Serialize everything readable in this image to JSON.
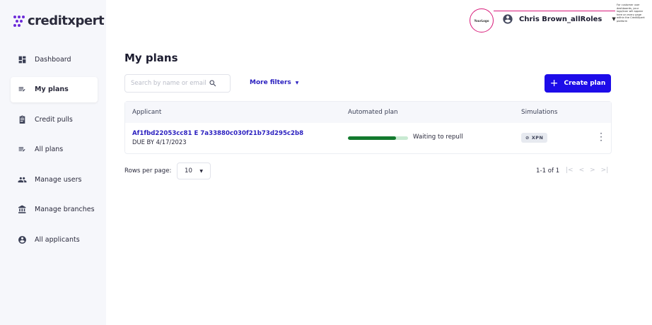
{
  "brand": {
    "name": "creditxpert",
    "color": "#6c2bd9"
  },
  "header": {
    "logo_placeholder": "YourLogo",
    "callout_note": "For customer user dashboards, your logo/icon will appear here on every page within the CreditXpert platform",
    "user_name": "Chris Brown_allRoles",
    "user_icon": "account-circle-icon"
  },
  "sidebar": {
    "items": [
      {
        "label": "Dashboard",
        "icon": "dashboard-icon",
        "active": false
      },
      {
        "label": "My plans",
        "icon": "list-check-icon",
        "active": true
      },
      {
        "label": "Credit pulls",
        "icon": "clipboard-icon",
        "active": false
      },
      {
        "label": "All plans",
        "icon": "list-check-icon",
        "active": false
      },
      {
        "label": "Manage users",
        "icon": "users-icon",
        "active": false
      },
      {
        "label": "Manage branches",
        "icon": "bank-icon",
        "active": false
      },
      {
        "label": "All applicants",
        "icon": "account-circle-icon",
        "active": false
      }
    ]
  },
  "main": {
    "title": "My plans",
    "search": {
      "placeholder": "Search by name or email"
    },
    "more_filters_label": "More filters",
    "create_label": "Create plan",
    "accent": "#1d0ce9"
  },
  "table": {
    "columns": [
      "Applicant",
      "Automated plan",
      "Simulations"
    ],
    "rows": [
      {
        "applicant_id": "Af1fbd22053cc81 E 7a33880c030f21b73d295c2b8",
        "due": "DUE BY 4/17/2023",
        "progress": 0.8,
        "plan_status": "Waiting to repull",
        "simulation_badge": "XPN"
      }
    ]
  },
  "pagination": {
    "rows_per_page_label": "Rows per page:",
    "rows_per_page_value": "10",
    "range": "1-1 of 1"
  }
}
